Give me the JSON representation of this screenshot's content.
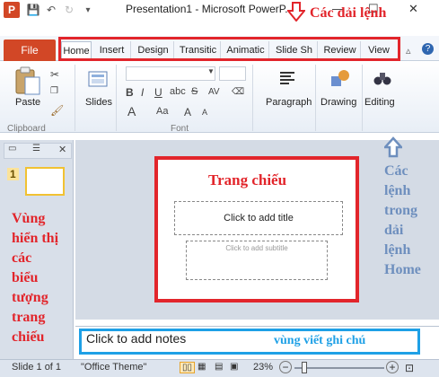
{
  "window": {
    "title": "Presentation1 - Microsoft PowerP...",
    "app_logo": "P",
    "minimize": "—",
    "maximize": "☐",
    "close": "✕"
  },
  "quick_access": {
    "save_icon": "💾",
    "undo_icon": "↶",
    "redo_icon": "↻",
    "more_icon": "▾"
  },
  "tabs": {
    "file": "File",
    "items": [
      "Home",
      "Insert",
      "Design",
      "Transitic",
      "Animatic",
      "Slide Sh",
      "Review",
      "View"
    ],
    "active": "Home",
    "help_icon": "?"
  },
  "ribbon": {
    "paste_label": "Paste",
    "slides_label": "Slides",
    "paragraph_label": "Paragraph",
    "drawing_label": "Drawing",
    "editing_label": "Editing",
    "clipboard_label": "Clipboard",
    "font_label": "Font",
    "bold": "B",
    "italic": "I",
    "underline": "U",
    "strike": "S",
    "shadow": "abc",
    "spacing": "AV",
    "grow": "A",
    "shrink": "A",
    "case": "Aa",
    "color": "A"
  },
  "slide_pane": {
    "slide_number": "1"
  },
  "slide": {
    "title_placeholder": "Click to add title",
    "subtitle_placeholder": "Click to add subtitle"
  },
  "notes": {
    "placeholder": "Click to add notes"
  },
  "status": {
    "slide_info": "Slide 1 of 1",
    "theme": "\"Office Theme\"",
    "zoom": "23%"
  },
  "annotations": {
    "ribbon_tabs": "Các dải lệnh",
    "slide_area": "Trang chiếu",
    "ribbon_commands": [
      "Các",
      "lệnh",
      "trong",
      "dải",
      "lệnh",
      "Home"
    ],
    "thumbnail_area": [
      "Vùng",
      "hiển thị",
      "các",
      "biểu",
      "tượng",
      "trang",
      "chiếu"
    ],
    "notes_area": "vùng viết ghi chú"
  },
  "colors": {
    "annotation_red": "#e2252b",
    "annotation_blue": "#6e8fbe",
    "notes_box": "#1ea0e6",
    "file_tab": "#d24726"
  }
}
